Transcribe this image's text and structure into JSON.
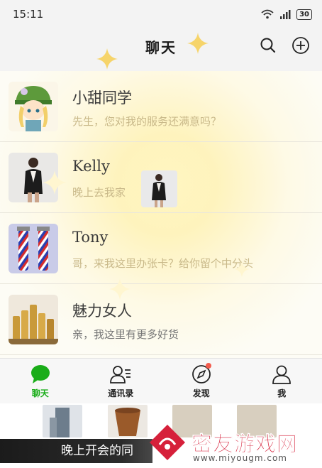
{
  "status": {
    "time": "15:11",
    "battery": "30"
  },
  "header": {
    "title": "聊天"
  },
  "chats": [
    {
      "name": "小甜同学",
      "message": "先生，您对我的服务还满意吗？"
    },
    {
      "name": "Kelly",
      "message": "晚上去我家"
    },
    {
      "name": "Tony",
      "message": "哥，来我这里办张卡？给你留个中分头"
    },
    {
      "name": "魅力女人",
      "message": "亲，我这里有更多好货"
    }
  ],
  "tabs": [
    {
      "label": "聊天",
      "icon": "chat-bubble-icon",
      "active": true
    },
    {
      "label": "通讯录",
      "icon": "contacts-icon",
      "active": false
    },
    {
      "label": "发现",
      "icon": "compass-icon",
      "active": false
    },
    {
      "label": "我",
      "icon": "person-icon",
      "active": false
    }
  ],
  "overlay": {
    "caption": "晚上开会的同"
  },
  "watermark": {
    "text": "密友游戏网",
    "url": "www.miyougm.com"
  },
  "colors": {
    "accent": "#1aad19",
    "badge": "#f25b4d",
    "watermark": "#d6203a"
  }
}
